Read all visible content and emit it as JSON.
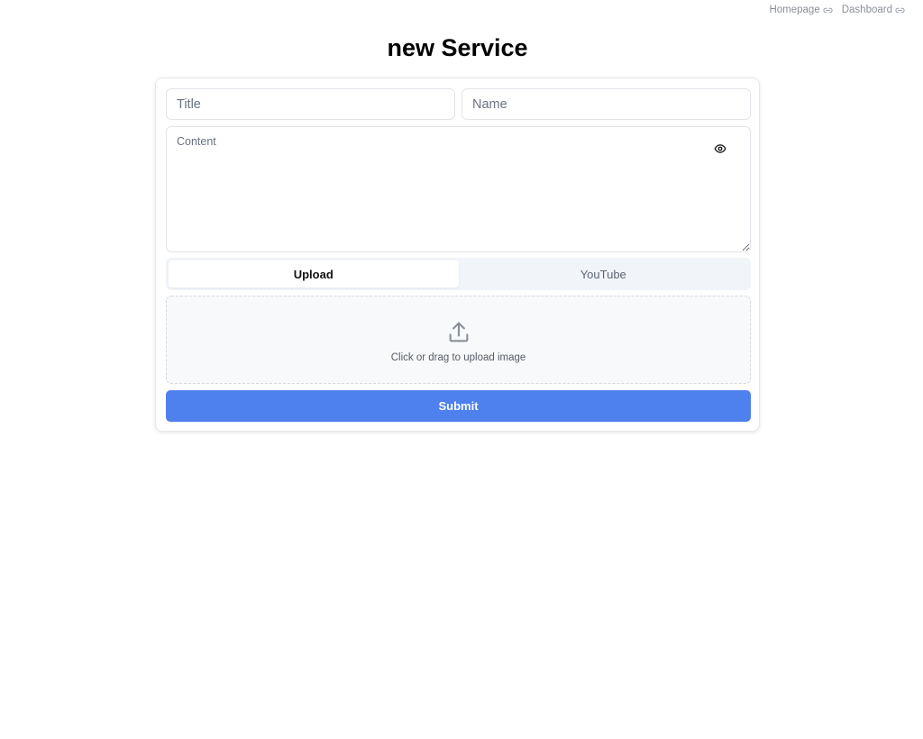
{
  "nav": {
    "links": [
      {
        "label": "Homepage",
        "icon": "link-icon"
      },
      {
        "label": "Dashboard",
        "icon": "link-icon"
      }
    ]
  },
  "page": {
    "title": "new Service"
  },
  "form": {
    "title_placeholder": "Title",
    "title_value": "",
    "name_placeholder": "Name",
    "name_value": "",
    "content_placeholder": "Content",
    "content_value": "",
    "preview_icon": "eye-icon",
    "tabs": [
      {
        "label": "Upload",
        "active": true
      },
      {
        "label": "YouTube",
        "active": false
      }
    ],
    "upload": {
      "icon": "upload-icon",
      "text": "Click or drag to upload image"
    },
    "submit_label": "Submit"
  },
  "colors": {
    "accent": "#4e80ee",
    "tab_bg": "#f1f4f8",
    "border": "#e2e4e9"
  }
}
